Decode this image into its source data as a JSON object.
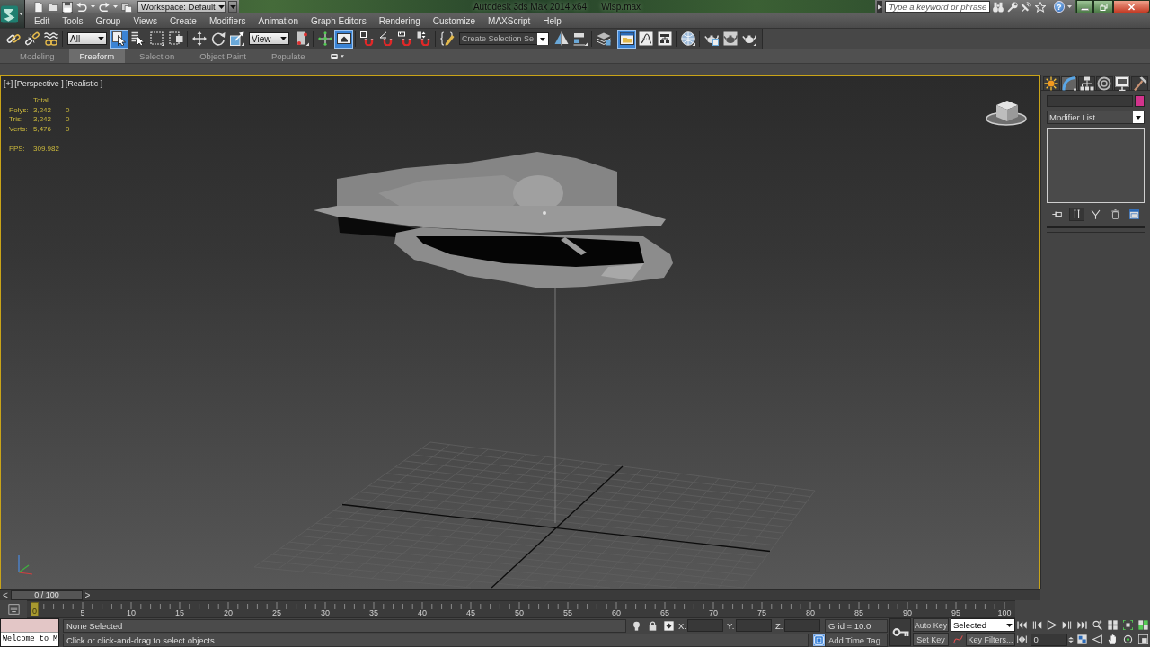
{
  "title_bar": {
    "workspace": "Workspace: Default",
    "app_title": "Autodesk 3ds Max  2014 x64",
    "file_name": "Wisp.max",
    "search": {
      "placeholder": "Type a keyword or phrase"
    },
    "help": "?"
  },
  "menu_bar": [
    "Edit",
    "Tools",
    "Group",
    "Views",
    "Create",
    "Modifiers",
    "Animation",
    "Graph Editors",
    "Rendering",
    "Customize",
    "MAXScript",
    "Help"
  ],
  "main_toolbar": [
    {
      "kind": "button",
      "active": false
    },
    {
      "kind": "button",
      "active": false
    },
    {
      "kind": "button",
      "active": false
    },
    {
      "kind": "dropdown",
      "value": "All"
    },
    {
      "kind": "button",
      "active": true
    },
    {
      "kind": "button",
      "active": false
    },
    {
      "kind": "button",
      "active": false
    },
    {
      "kind": "button",
      "active": false
    },
    {
      "kind": "button",
      "active": false
    },
    {
      "kind": "button",
      "active": false
    },
    {
      "kind": "button",
      "active": false
    },
    {
      "kind": "dropdown",
      "value": "View"
    },
    {
      "kind": "button",
      "active": false
    },
    {
      "kind": "button",
      "active": false
    },
    {
      "kind": "button",
      "active": true
    },
    {
      "kind": "button",
      "active": false
    },
    {
      "kind": "button",
      "active": false
    },
    {
      "kind": "button",
      "active": false
    },
    {
      "kind": "button",
      "active": false
    },
    {
      "kind": "button",
      "active": false
    },
    {
      "kind": "dropdown",
      "value": "Create Selection Se"
    },
    {
      "kind": "button",
      "active": false
    },
    {
      "kind": "button",
      "active": false
    },
    {
      "kind": "button",
      "active": false
    },
    {
      "kind": "button",
      "active": true
    },
    {
      "kind": "button",
      "active": false
    },
    {
      "kind": "button",
      "active": false
    },
    {
      "kind": "button",
      "active": false
    },
    {
      "kind": "button",
      "active": false
    },
    {
      "kind": "button",
      "active": false
    },
    {
      "kind": "button",
      "active": false
    }
  ],
  "ribbon_tabs": [
    {
      "label": "Modeling",
      "selected": false
    },
    {
      "label": "Freeform",
      "selected": true
    },
    {
      "label": "Selection",
      "selected": false
    },
    {
      "label": "Object Paint",
      "selected": false
    },
    {
      "label": "Populate",
      "selected": false
    }
  ],
  "viewport": {
    "labels": [
      "[+]",
      "[Perspective ]",
      "[Realistic ]"
    ],
    "statistics": {
      "header": "Total",
      "rows": [
        {
          "label": "Polys:",
          "total": "3,242",
          "column_3": "0"
        },
        {
          "label": "Tris:",
          "total": "3,242",
          "column_3": "0"
        },
        {
          "label": "Verts:",
          "total": "5,476",
          "column_3": "0"
        }
      ],
      "fps_label": "FPS:",
      "fps": "309.982"
    }
  },
  "command_panel": {
    "tabs": [
      {
        "selected": false
      },
      {
        "selected": true
      },
      {
        "selected": false
      },
      {
        "selected": false
      },
      {
        "selected": false
      },
      {
        "selected": false
      }
    ],
    "color_swatch": {
      "color": "#d2338c"
    },
    "modifier_list": "Modifier List",
    "stack_buttons": [
      {
        "active": false
      },
      {
        "active": true
      },
      {
        "active": false
      },
      {
        "active": false
      },
      {
        "active": false
      }
    ]
  },
  "time_slider": {
    "previous": "<",
    "position": "0 / 100",
    "next": ">",
    "level": 0
  },
  "track_bar": {
    "current_frame": "0",
    "labels": [
      "5",
      "10",
      "15",
      "20",
      "25",
      "30",
      "35",
      "40",
      "45",
      "50",
      "55",
      "60",
      "65",
      "70",
      "75",
      "80",
      "85",
      "90",
      "95",
      "100"
    ]
  },
  "maxscript_listener": {
    "output": "Welcome to M"
  },
  "status_bar": {
    "selection": "None Selected",
    "prompt": "Click or click-and-drag to select objects",
    "toggles": [
      {
        "active": false
      },
      {
        "active": false
      },
      {
        "active": false
      },
      {
        "active": true
      }
    ],
    "coordinates": [
      {
        "axis": "X:"
      },
      {
        "axis": "Y:"
      },
      {
        "axis": "Z:"
      }
    ],
    "grid": "Grid = 10.0",
    "add_time_tag": "Add Time Tag",
    "auto_key": {
      "label": "Auto Key",
      "active": false
    },
    "set_key": "Set Key",
    "key_mode": "Selected",
    "key_filters": "Key Filters...",
    "current_frame": "0"
  }
}
